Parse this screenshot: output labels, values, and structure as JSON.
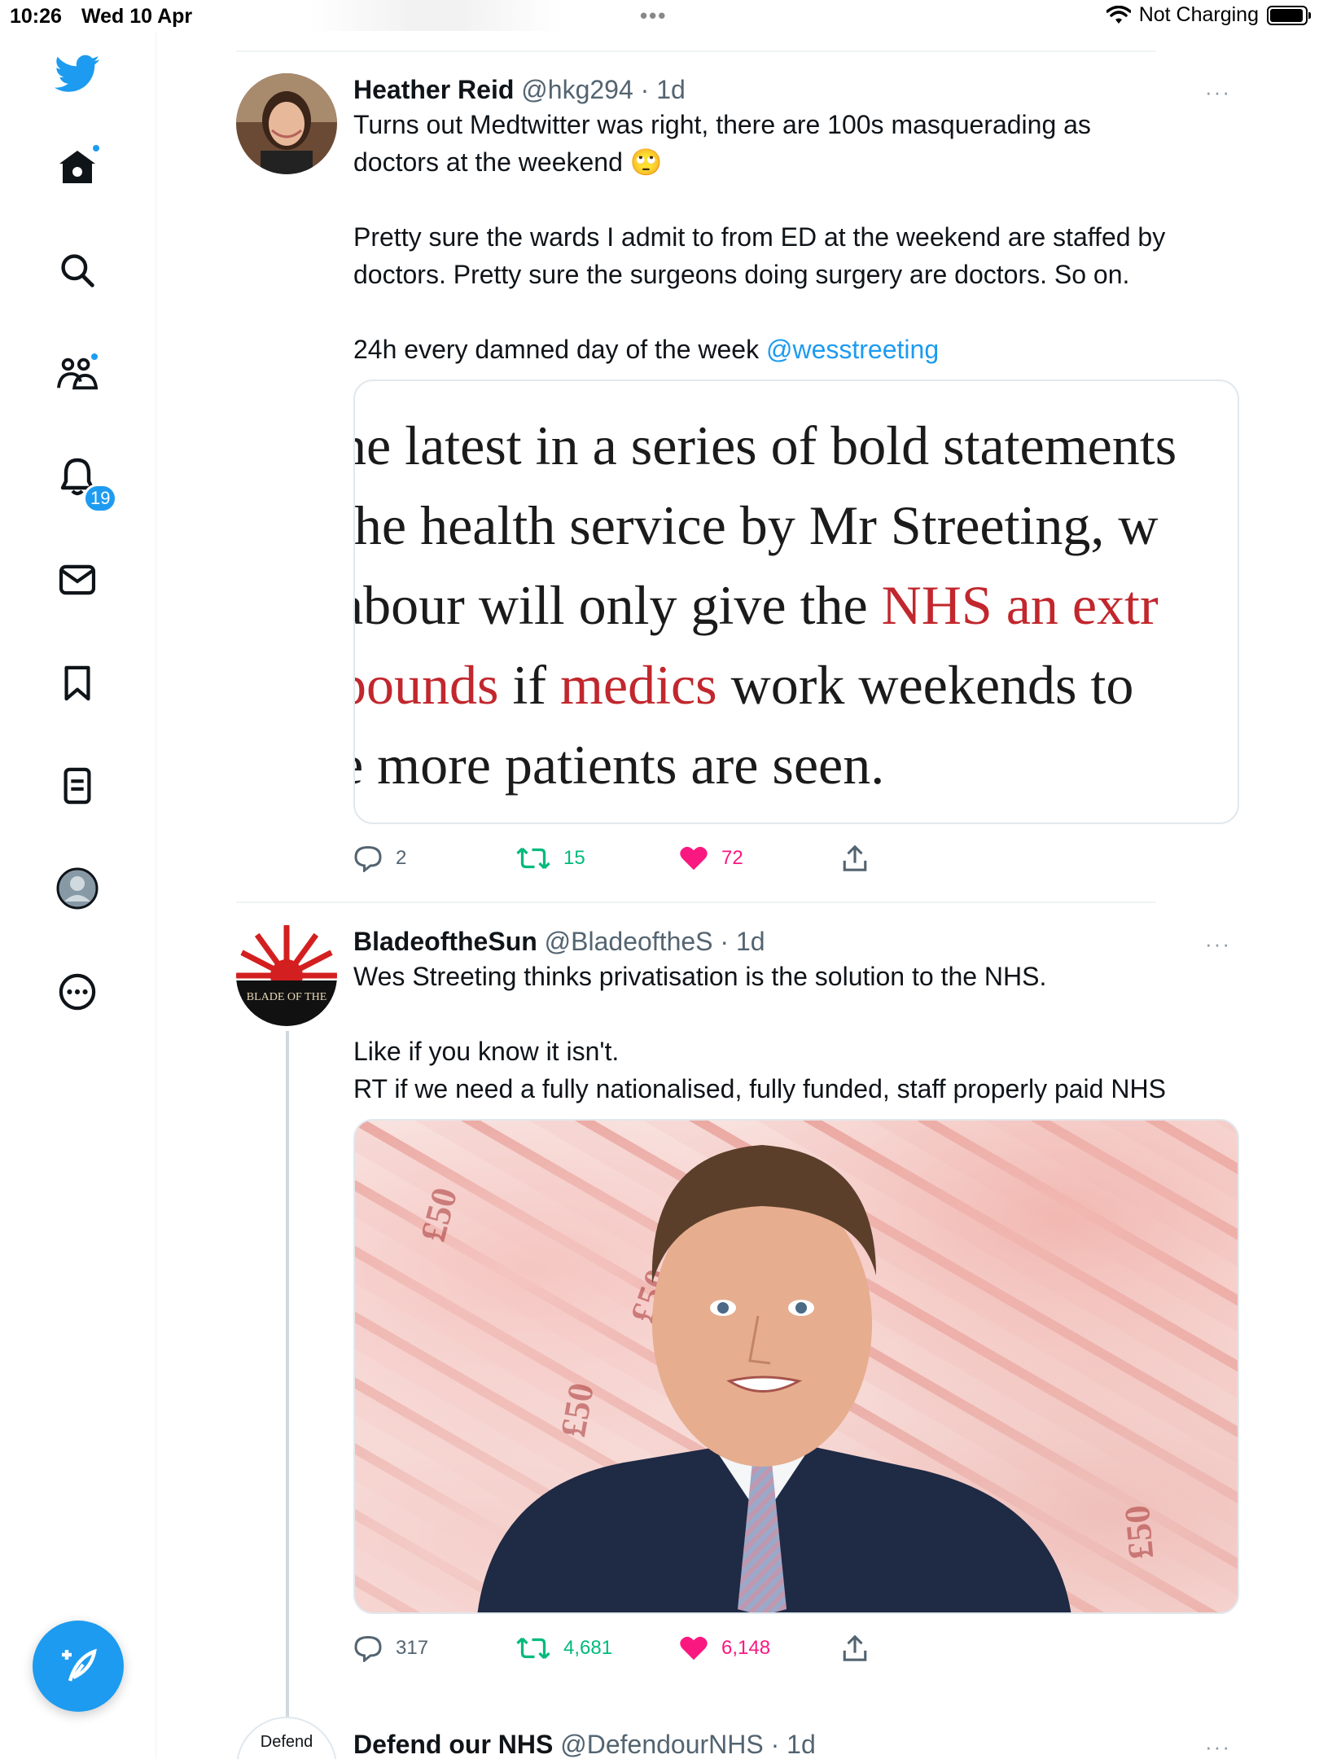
{
  "status_bar": {
    "time": "10:26",
    "date": "Wed 10 Apr",
    "dots": "•••",
    "charging": "Not Charging",
    "battery_level": 0.95
  },
  "sidebar": {
    "notifications_badge": "19",
    "items": [
      {
        "name": "twitter-logo-icon"
      },
      {
        "name": "home-icon"
      },
      {
        "name": "search-icon"
      },
      {
        "name": "communities-icon"
      },
      {
        "name": "notifications-icon"
      },
      {
        "name": "messages-icon"
      },
      {
        "name": "bookmarks-icon"
      },
      {
        "name": "lists-icon"
      },
      {
        "name": "profile-icon"
      },
      {
        "name": "more-icon"
      },
      {
        "name": "compose-tweet-icon"
      }
    ],
    "accent_color": "#1d9bf0"
  },
  "tweets": [
    {
      "name": "Heather Reid",
      "handle": "@hkg294",
      "sep": "·",
      "time": "1d",
      "more": "···",
      "text_line1": "Turns out Medtwitter was right, there are 100s masquerading as",
      "text_line2": "doctors at the weekend",
      "emoji": "🙄",
      "text_para2_line1": "Pretty sure the wards I admit to from ED at the weekend are staffed by",
      "text_para2_line2": "doctors. Pretty sure the surgeons doing surgery are doctors. So on.",
      "text_para3": "24h every damned day of the week ",
      "mention": "@wesstreeting",
      "article": {
        "line1": "he latest in a series of bold statements",
        "line2": "the health service by Mr Streeting, w",
        "line3_a": "abour will only give the ",
        "line3_b": "NHS an extr",
        "line4_a": "pounds",
        "line4_b": " if ",
        "line4_c": "medics",
        "line4_d": " work weekends to",
        "line5": "e more patients are seen."
      },
      "replies": "2",
      "retweets": "15",
      "likes": "72"
    },
    {
      "name": "BladeoftheSun",
      "handle": "@BladeoftheS",
      "sep": "·",
      "time": "1d",
      "more": "···",
      "avatar_text": "BLADE OF THE",
      "text_line1": "Wes Streeting thinks privatisation is the solution to the NHS.",
      "text_para2_line1": "Like if you know it isn't.",
      "text_para2_line2": "RT if we need a fully nationalised, fully funded, staff properly paid NHS",
      "photo_note_label": "£50",
      "replies": "317",
      "retweets": "4,681",
      "likes": "6,148"
    },
    {
      "name": "Defend our NHS",
      "handle": "@DefendourNHS",
      "sep": "·",
      "time": "1d",
      "more": "···",
      "avatar_text": "Defend"
    }
  ]
}
